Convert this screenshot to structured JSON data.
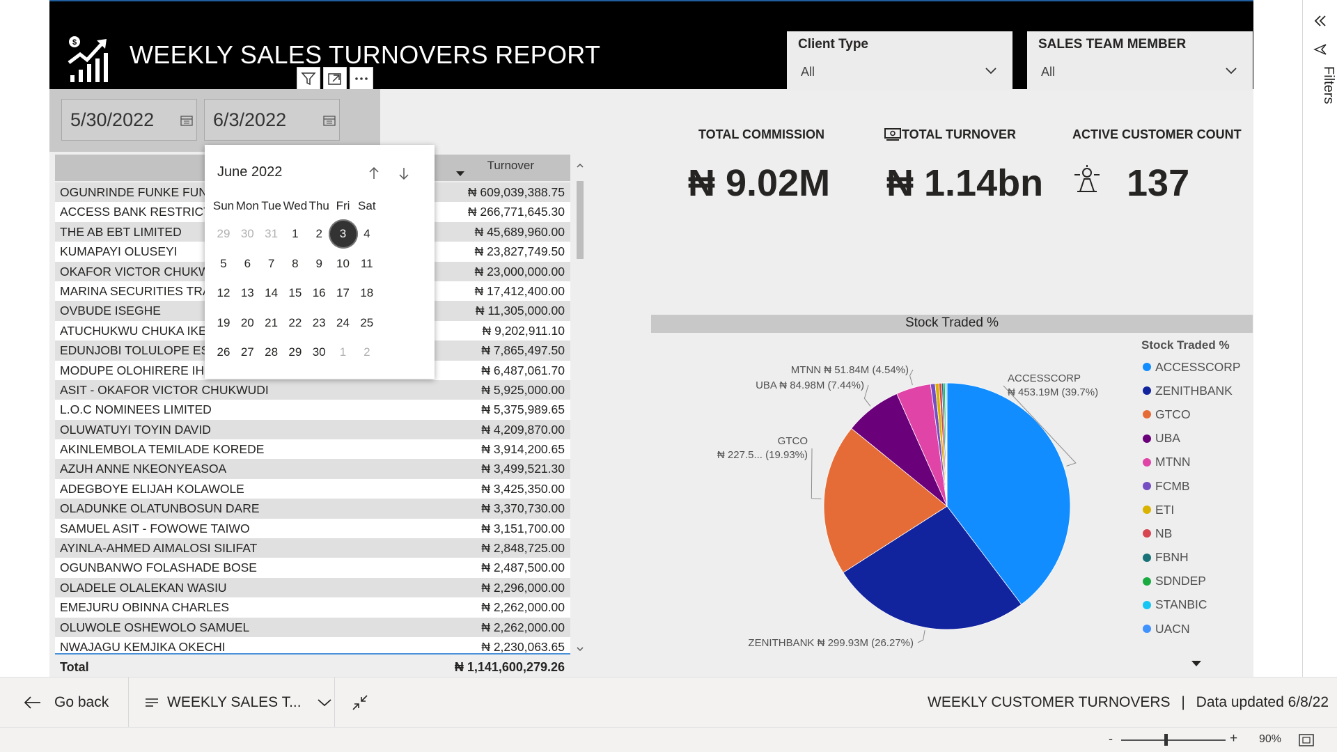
{
  "header": {
    "title": "WEEKLY SALES TURNOVERS REPORT",
    "slicers": [
      {
        "title": "Client Type",
        "value": "All"
      },
      {
        "title": "SALES TEAM MEMBER",
        "value": "All"
      }
    ],
    "visual_header_icons": [
      "filter-icon",
      "focus-mode-icon",
      "more-options-icon"
    ]
  },
  "date_slicer": {
    "start": "5/30/2022",
    "end": "6/3/2022"
  },
  "calendar": {
    "month_label": "June 2022",
    "weekdays": [
      "Sun",
      "Mon",
      "Tue",
      "Wed",
      "Thu",
      "Fri",
      "Sat"
    ],
    "weeks": [
      [
        "29",
        "30",
        "31",
        "1",
        "2",
        "3",
        "4"
      ],
      [
        "5",
        "6",
        "7",
        "8",
        "9",
        "10",
        "11"
      ],
      [
        "12",
        "13",
        "14",
        "15",
        "16",
        "17",
        "18"
      ],
      [
        "19",
        "20",
        "21",
        "22",
        "23",
        "24",
        "25"
      ],
      [
        "26",
        "27",
        "28",
        "29",
        "30",
        "1",
        "2"
      ]
    ],
    "selected_day": "3"
  },
  "table": {
    "column_headers": [
      "",
      "Turnover"
    ],
    "rows": [
      {
        "name": "OGUNRINDE FUNKE FUNM",
        "turnover": "₦ 609,039,388.75"
      },
      {
        "name": "ACCESS BANK RESTRICTED",
        "turnover": "₦ 266,771,645.30"
      },
      {
        "name": "THE AB EBT LIMITED",
        "turnover": "₦ 45,689,960.00"
      },
      {
        "name": "KUMAPAYI OLUSEYI",
        "turnover": "₦ 23,827,749.50"
      },
      {
        "name": "OKAFOR VICTOR CHUKWU",
        "turnover": "₦ 23,000,000.00"
      },
      {
        "name": "MARINA SECURITIES TRAD",
        "turnover": "₦ 17,412,400.00"
      },
      {
        "name": "OVBUDE ISEGHE",
        "turnover": "₦ 11,305,000.00"
      },
      {
        "name": "ATUCHUKWU CHUKA IKEN",
        "turnover": "₦ 9,202,911.10"
      },
      {
        "name": "EDUNJOBI TOLULOPE ESTH",
        "turnover": "₦ 7,865,497.50"
      },
      {
        "name": "MODUPE OLOHIRERE IHIM",
        "turnover": "₦ 6,487,061.70"
      },
      {
        "name": "ASIT - OKAFOR VICTOR CHUKWUDI",
        "turnover": "₦ 5,925,000.00"
      },
      {
        "name": "L.O.C NOMINEES LIMITED",
        "turnover": "₦ 5,375,989.65"
      },
      {
        "name": "OLUWATUYI TOYIN DAVID",
        "turnover": "₦ 4,209,870.00"
      },
      {
        "name": "AKINLEMBOLA TEMILADE KOREDE",
        "turnover": "₦ 3,914,200.65"
      },
      {
        "name": "AZUH ANNE NKEONYEASOA",
        "turnover": "₦ 3,499,521.30"
      },
      {
        "name": "ADEGBOYE ELIJAH KOLAWOLE",
        "turnover": "₦ 3,425,350.00"
      },
      {
        "name": "OLADUNKE OLATUNBOSUN DARE",
        "turnover": "₦ 3,370,730.00"
      },
      {
        "name": "SAMUEL ASIT - FOWOWE TAIWO",
        "turnover": "₦ 3,151,700.00"
      },
      {
        "name": "AYINLA-AHMED AIMALOSI SILIFAT",
        "turnover": "₦ 2,848,725.00"
      },
      {
        "name": "OGUNBANWO FOLASHADE BOSE",
        "turnover": "₦ 2,487,500.00"
      },
      {
        "name": "OLADELE OLALEKAN WASIU",
        "turnover": "₦ 2,296,000.00"
      },
      {
        "name": "EMEJURU OBINNA CHARLES",
        "turnover": "₦ 2,262,000.00"
      },
      {
        "name": "OLUWOLE OSHEWOLO SAMUEL",
        "turnover": "₦ 2,262,000.00"
      },
      {
        "name": "NWAJAGU KEMJIKA OKECHI",
        "turnover": "₦ 2,230,063.65"
      }
    ],
    "total_label": "Total",
    "total_value": "₦ 1,141,600,279.26"
  },
  "kpis": {
    "total_commission": {
      "title": "TOTAL COMMISSION",
      "value": "₦ 9.02M"
    },
    "total_turnover": {
      "title": "TOTAL TURNOVER",
      "value": "₦ 1.14bn"
    },
    "active_customers": {
      "title": "ACTIVE CUSTOMER COUNT",
      "value": "137"
    }
  },
  "chart_data": {
    "type": "pie",
    "title": "Stock Traded %",
    "legend_title": "Stock Traded %",
    "legend_placement": "right",
    "slices": [
      {
        "name": "ACCESSCORP",
        "value_label": "₦ 453.19M (39.7%)",
        "percent": 39.7,
        "color": "#118DFF"
      },
      {
        "name": "ZENITHBANK",
        "value_label": "₦ 299.93M (26.27%)",
        "percent": 26.27,
        "color": "#12239E"
      },
      {
        "name": "GTCO",
        "value_label": "₦ 227.5... (19.93%)",
        "percent": 19.93,
        "color": "#E66C37"
      },
      {
        "name": "UBA",
        "value_label": "₦ 84.98M (7.44%)",
        "percent": 7.44,
        "color": "#6B007B"
      },
      {
        "name": "MTNN",
        "value_label": "₦ 51.84M (4.54%)",
        "percent": 4.54,
        "color": "#E044A7"
      },
      {
        "name": "FCMB",
        "value_label": "",
        "percent": 0.6,
        "color": "#744EC2"
      },
      {
        "name": "ETI",
        "value_label": "",
        "percent": 0.5,
        "color": "#D9B300"
      },
      {
        "name": "NB",
        "value_label": "",
        "percent": 0.35,
        "color": "#D64550"
      },
      {
        "name": "FBNH",
        "value_label": "",
        "percent": 0.25,
        "color": "#197278"
      },
      {
        "name": "SDNDEP",
        "value_label": "",
        "percent": 0.2,
        "color": "#1AAB40"
      },
      {
        "name": "STANBIC",
        "value_label": "",
        "percent": 0.15,
        "color": "#15C6F4"
      },
      {
        "name": "UACN",
        "value_label": "",
        "percent": 0.1,
        "color": "#4092FF"
      }
    ]
  },
  "filters_pane": {
    "label": "Filters"
  },
  "bottom_bar": {
    "go_back": "Go back",
    "page_name": "WEEKLY SALES T...",
    "report_name": "WEEKLY CUSTOMER TURNOVERS",
    "separator": "|",
    "data_updated": "Data updated 6/8/22"
  },
  "status_bar": {
    "zoom_minus": "-",
    "zoom_plus": "+",
    "zoom_level": "90%"
  }
}
